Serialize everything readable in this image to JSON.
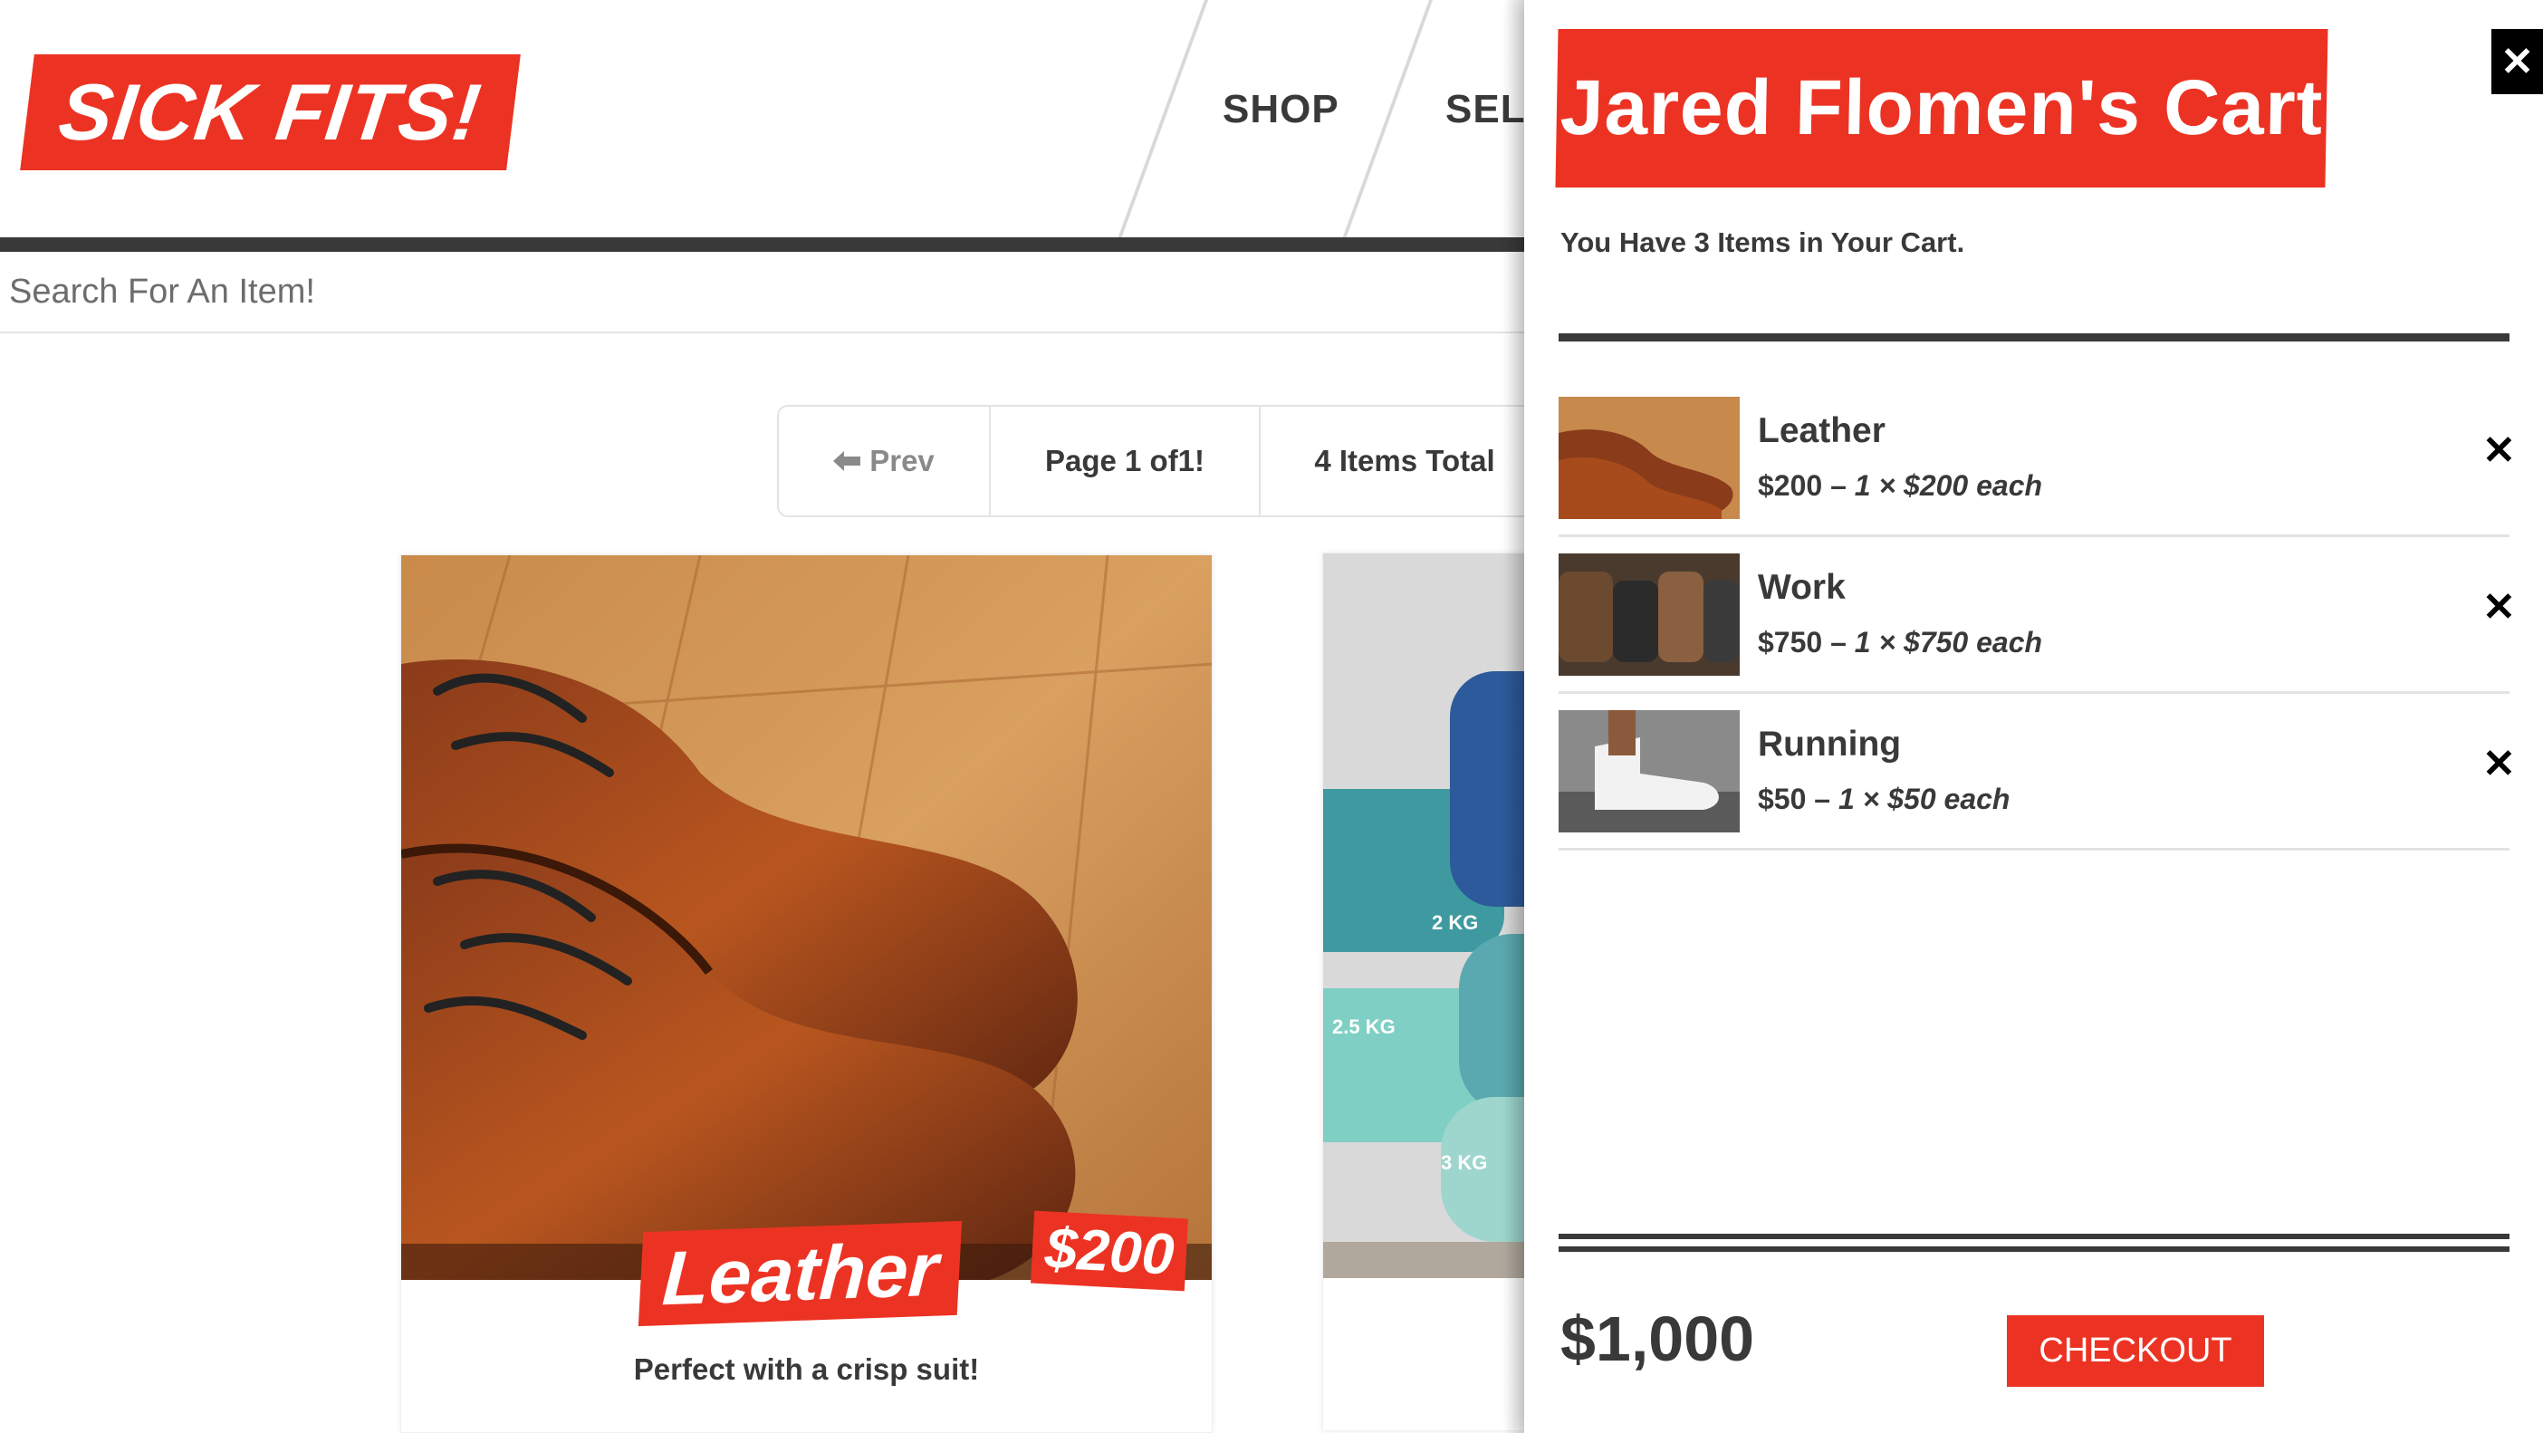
{
  "header": {
    "logo": "SICK FITS!",
    "nav": [
      "SHOP",
      "SELL"
    ]
  },
  "search": {
    "placeholder": "Search For An Item!"
  },
  "pagination": {
    "prev": "Prev",
    "page": "Page 1 of1!",
    "total": "4 Items Total"
  },
  "products": [
    {
      "title": "Leather",
      "price": "$200",
      "description": "Perfect with a crisp suit!"
    },
    {
      "title": "",
      "price": "",
      "description": ""
    }
  ],
  "cart": {
    "title": "Jared Flomen's Cart",
    "count_text": "You Have 3 Items in Your Cart.",
    "items": [
      {
        "name": "Leather",
        "total": "$200",
        "sep": " – ",
        "each": "1 × $200 each"
      },
      {
        "name": "Work",
        "total": "$750",
        "sep": " – ",
        "each": "1 × $750 each"
      },
      {
        "name": "Running",
        "total": "$50",
        "sep": " – ",
        "each": "1 × $50 each"
      }
    ],
    "total": "$1,000",
    "checkout": "CHECKOUT",
    "close_glyph": "✕",
    "remove_glyph": "✕"
  },
  "colors": {
    "brand_red": "#ec3323",
    "dark": "#393939"
  },
  "icons": [
    "close-icon",
    "remove-icon",
    "left-arrow-icon"
  ]
}
